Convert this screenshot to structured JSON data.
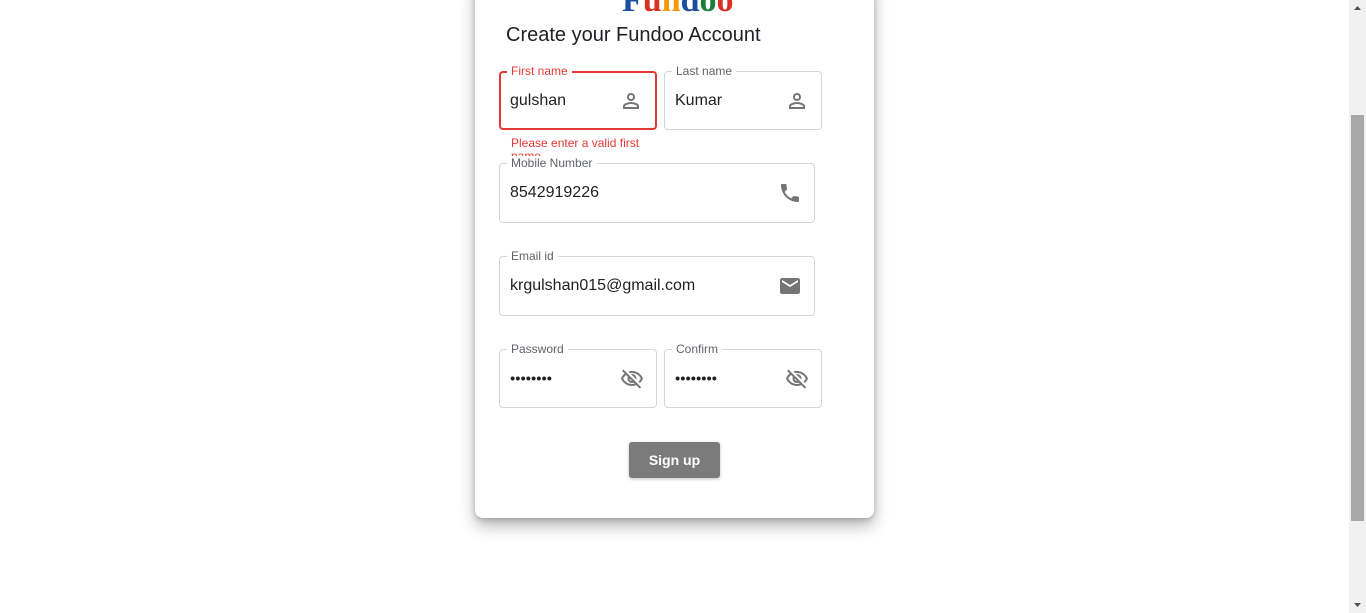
{
  "logo": {
    "letters": [
      {
        "ch": "F",
        "color": "#1a4fa0"
      },
      {
        "ch": "u",
        "color": "#d93025"
      },
      {
        "ch": "n",
        "color": "#f29900"
      },
      {
        "ch": "d",
        "color": "#1a4fa0"
      },
      {
        "ch": "o",
        "color": "#188038"
      },
      {
        "ch": "o",
        "color": "#d93025"
      }
    ]
  },
  "heading": "Create your Fundoo Account",
  "form": {
    "first_name": {
      "label": "First name",
      "value": "gulshan",
      "icon": "person-icon",
      "error": "Please enter a valid first name"
    },
    "last_name": {
      "label": "Last name",
      "value": "Kumar",
      "icon": "person-icon"
    },
    "mobile": {
      "label": "Mobile Number",
      "value": "8542919226",
      "icon": "phone-icon"
    },
    "email": {
      "label": "Email id",
      "value": "krgulshan015@gmail.com",
      "icon": "mail-icon"
    },
    "password": {
      "label": "Password",
      "value": "••••••••",
      "icon": "visibility-off-icon"
    },
    "confirm": {
      "label": "Confirm",
      "value": "••••••••",
      "icon": "visibility-off-icon"
    }
  },
  "signup_button": "Sign up",
  "colors": {
    "error": "#e53935",
    "button": "#7b7b7b",
    "icon": "#757575"
  }
}
